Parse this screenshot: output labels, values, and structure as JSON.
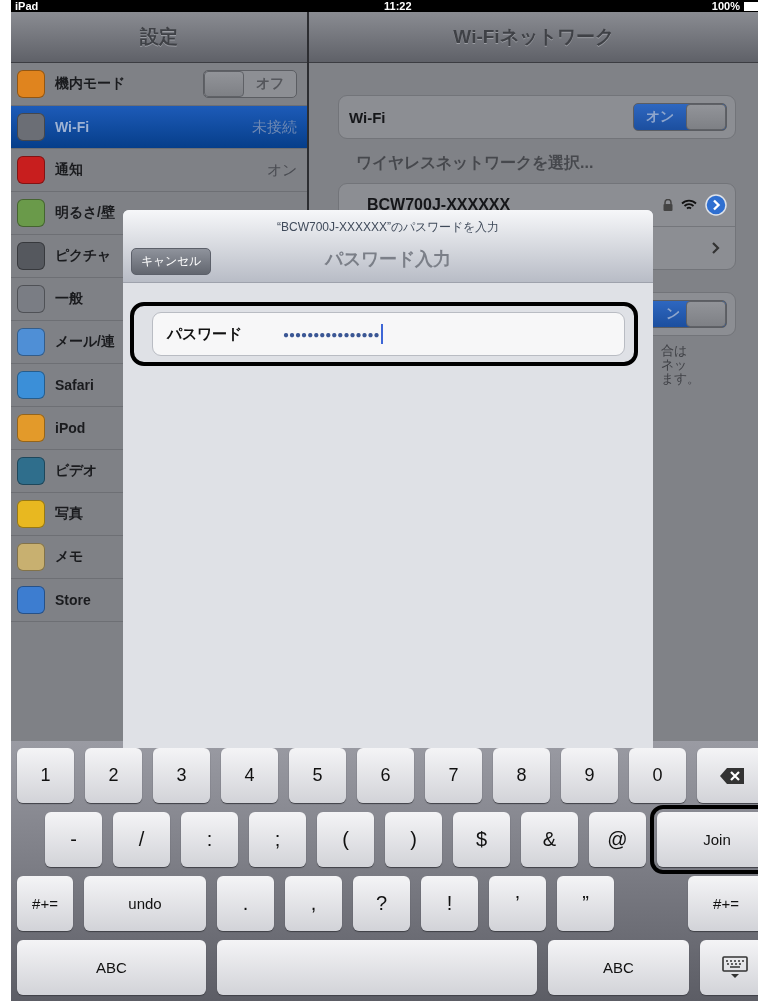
{
  "status_bar": {
    "device": "iPad",
    "time": "11:22",
    "battery": "100%"
  },
  "sidebar": {
    "title": "設定",
    "items": [
      {
        "label": "機内モード",
        "selected": false,
        "toggle": {
          "label": "オフ",
          "on": false
        }
      },
      {
        "label": "Wi-Fi",
        "selected": true,
        "value": "未接続"
      },
      {
        "label": "通知",
        "selected": false,
        "value": "オン"
      },
      {
        "label": "明るさ/壁",
        "selected": false
      },
      {
        "label": "ピクチャ",
        "selected": false
      },
      {
        "label": "一般",
        "selected": false
      },
      {
        "label": "メール/連",
        "selected": false
      },
      {
        "label": "Safari",
        "selected": false
      },
      {
        "label": "iPod",
        "selected": false
      },
      {
        "label": "ビデオ",
        "selected": false
      },
      {
        "label": "写真",
        "selected": false
      },
      {
        "label": "メモ",
        "selected": false
      },
      {
        "label": "Store",
        "selected": false
      }
    ]
  },
  "detail": {
    "title": "Wi-Fiネットワーク",
    "wifi": {
      "label": "Wi-Fi",
      "toggle": {
        "label": "オン",
        "on": true
      }
    },
    "section_heading": "ワイヤレスネットワークを選択...",
    "networks": [
      {
        "name": "BCW700J-XXXXXX",
        "locked": true
      }
    ],
    "second_toggle": {
      "label": "ン",
      "on": true
    },
    "footer_lines": [
      "合は",
      "ネッ",
      "ます。"
    ]
  },
  "dialog": {
    "subtitle": "“BCW700J-XXXXXX”のパスワードを入力",
    "title": "パスワード入力",
    "cancel": "キャンセル",
    "field": {
      "label": "パスワード",
      "value": "●●●●●●●●●●●●●●●●",
      "highlighted": true
    }
  },
  "keyboard": {
    "rows": [
      [
        {
          "kind": "char",
          "label": "1"
        },
        {
          "kind": "char",
          "label": "2"
        },
        {
          "kind": "char",
          "label": "3"
        },
        {
          "kind": "char",
          "label": "4"
        },
        {
          "kind": "char",
          "label": "5"
        },
        {
          "kind": "char",
          "label": "6"
        },
        {
          "kind": "char",
          "label": "7"
        },
        {
          "kind": "char",
          "label": "8"
        },
        {
          "kind": "char",
          "label": "9"
        },
        {
          "kind": "char",
          "label": "0"
        },
        {
          "kind": "delete"
        }
      ],
      [
        {
          "kind": "char",
          "label": "-"
        },
        {
          "kind": "char",
          "label": "/"
        },
        {
          "kind": "char",
          "label": ":"
        },
        {
          "kind": "char",
          "label": ";"
        },
        {
          "kind": "char",
          "label": "("
        },
        {
          "kind": "char",
          "label": ")"
        },
        {
          "kind": "char",
          "label": "$"
        },
        {
          "kind": "char",
          "label": "&"
        },
        {
          "kind": "char",
          "label": "@"
        },
        {
          "kind": "action",
          "label": "Join",
          "highlighted": true
        }
      ],
      [
        {
          "kind": "mode",
          "label": "#+="
        },
        {
          "kind": "wide",
          "label": "undo"
        },
        {
          "kind": "char",
          "label": "."
        },
        {
          "kind": "char",
          "label": ","
        },
        {
          "kind": "char",
          "label": "?"
        },
        {
          "kind": "char",
          "label": "!"
        },
        {
          "kind": "char",
          "label": "’"
        },
        {
          "kind": "char",
          "label": "”"
        },
        {
          "kind": "mode",
          "label": "#+="
        }
      ],
      [
        {
          "kind": "wide",
          "label": "ABC"
        },
        {
          "kind": "space"
        },
        {
          "kind": "wide",
          "label": "ABC"
        },
        {
          "kind": "hide"
        }
      ]
    ]
  }
}
